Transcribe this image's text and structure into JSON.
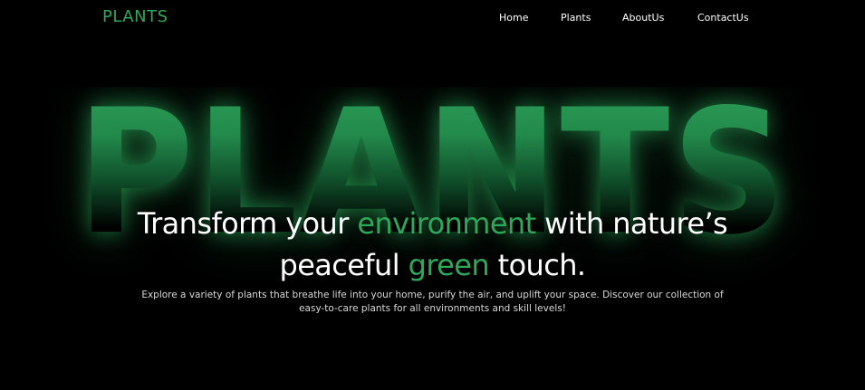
{
  "navbar": {
    "logo": "PLANTS",
    "links": [
      {
        "label": "Home"
      },
      {
        "label": "Plants"
      },
      {
        "label": "AboutUs"
      },
      {
        "label": "ContactUs"
      }
    ]
  },
  "hero": {
    "background_word": "PLANTS",
    "title": {
      "part1": "Transform your ",
      "accent1": "environment",
      "part2": " with nature’s",
      "part3": "peaceful ",
      "accent2": "green",
      "part4": " touch."
    },
    "subtitle": "Explore a variety of plants that breathe life into your home, purify the air, and uplift your space. Discover our collection of easy-to-care plants for all environments and skill levels!"
  },
  "colors": {
    "background": "#000000",
    "accent": "#2ea85a",
    "text": "#ffffff"
  }
}
